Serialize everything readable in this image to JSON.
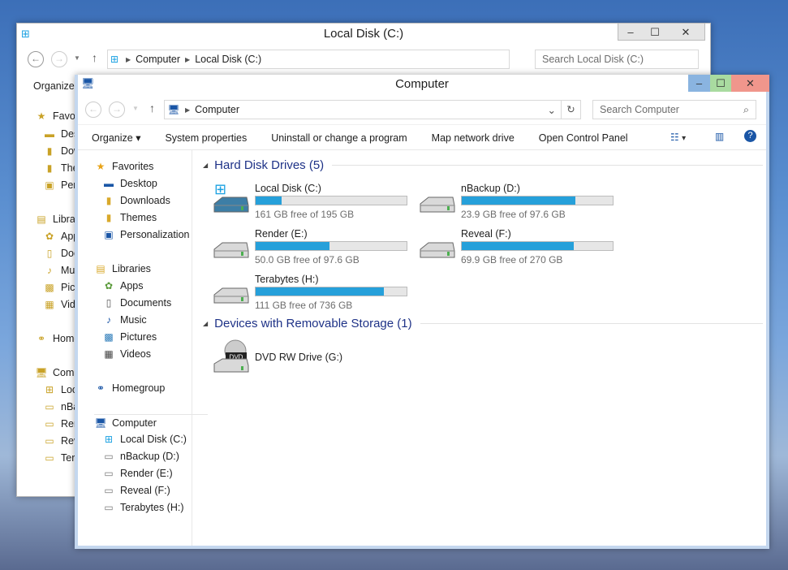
{
  "back_window": {
    "title": "Local Disk (C:)",
    "breadcrumb": [
      "Computer",
      "Local Disk (C:)"
    ],
    "search_placeholder": "Search Local Disk (C:)",
    "organize": "Organize",
    "sidebar": [
      "Favorites",
      "Desktop",
      "Downloads",
      "Themes",
      "Personalization",
      "Libraries",
      "Apps",
      "Documents",
      "Music",
      "Pictures",
      "Videos",
      "Homegroup",
      "Computer",
      "Local Disk (C:)",
      "nBackup (D:)",
      "Render (E:)",
      "Reveal (F:)",
      "Terabytes (H:)"
    ]
  },
  "front_window": {
    "title": "Computer",
    "breadcrumb": [
      "Computer"
    ],
    "search_placeholder": "Search Computer",
    "commands": [
      "Organize ▾",
      "System properties",
      "Uninstall or change a program",
      "Map network drive",
      "Open Control Panel"
    ],
    "sidebar": {
      "favorites": {
        "label": "Favorites",
        "items": [
          "Desktop",
          "Downloads",
          "Themes",
          "Personalization"
        ]
      },
      "libraries": {
        "label": "Libraries",
        "items": [
          "Apps",
          "Documents",
          "Music",
          "Pictures",
          "Videos"
        ]
      },
      "homegroup": "Homegroup",
      "computer": {
        "label": "Computer",
        "items": [
          "Local Disk (C:)",
          "nBackup (D:)",
          "Render (E:)",
          "Reveal (F:)",
          "Terabytes (H:)"
        ]
      }
    },
    "groups": [
      {
        "title": "Hard Disk Drives (5)",
        "drives": [
          {
            "name": "Local Disk (C:)",
            "free": "161 GB free of 195 GB",
            "used_fraction": 0.174,
            "system": true
          },
          {
            "name": "nBackup (D:)",
            "free": "23.9 GB free of 97.6 GB",
            "used_fraction": 0.755
          },
          {
            "name": "Render (E:)",
            "free": "50.0 GB free of 97.6 GB",
            "used_fraction": 0.488
          },
          {
            "name": "Reveal (F:)",
            "free": "69.9 GB free of 270 GB",
            "used_fraction": 0.741
          },
          {
            "name": "Terabytes (H:)",
            "free": "111 GB free of 736 GB",
            "used_fraction": 0.849
          }
        ]
      },
      {
        "title": "Devices with Removable Storage (1)",
        "devices": [
          {
            "name": "DVD RW Drive (G:)",
            "icon_label": "DVD"
          }
        ]
      }
    ]
  },
  "colors": {
    "accent": "#26a0da",
    "group_title": "#1e3287",
    "minimize": "#8ab4e0",
    "maximize": "#a9dba0",
    "close": "#f0968c"
  }
}
